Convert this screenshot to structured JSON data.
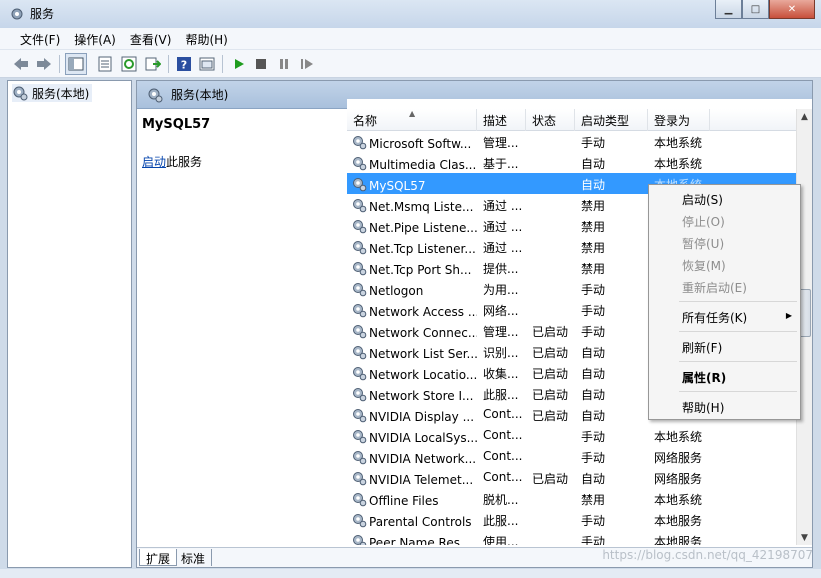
{
  "window": {
    "title": "服务"
  },
  "menubar": [
    "文件(F)",
    "操作(A)",
    "查看(V)",
    "帮助(H)"
  ],
  "tree": {
    "root": "服务(本地)"
  },
  "pane": {
    "header": "服务(本地)",
    "selected_service": "MySQL57",
    "start_link": "启动",
    "start_suffix": "此服务"
  },
  "columns": [
    "名称",
    "描述",
    "状态",
    "启动类型",
    "登录为"
  ],
  "rows": [
    {
      "name": "Microsoft Softw...",
      "desc": "管理...",
      "status": "",
      "startup": "手动",
      "logon": "本地系统"
    },
    {
      "name": "Multimedia Clas...",
      "desc": "基于...",
      "status": "",
      "startup": "自动",
      "logon": "本地系统"
    },
    {
      "name": "MySQL57",
      "desc": "",
      "status": "",
      "startup": "自动",
      "logon": "本地系统"
    },
    {
      "name": "Net.Msmq Liste...",
      "desc": "通过 ...",
      "status": "",
      "startup": "禁用",
      "logon": ""
    },
    {
      "name": "Net.Pipe Listene...",
      "desc": "通过 ...",
      "status": "",
      "startup": "禁用",
      "logon": ""
    },
    {
      "name": "Net.Tcp Listener...",
      "desc": "通过 ...",
      "status": "",
      "startup": "禁用",
      "logon": ""
    },
    {
      "name": "Net.Tcp Port Sh...",
      "desc": "提供...",
      "status": "",
      "startup": "禁用",
      "logon": ""
    },
    {
      "name": "Netlogon",
      "desc": "为用...",
      "status": "",
      "startup": "手动",
      "logon": ""
    },
    {
      "name": "Network Access ...",
      "desc": "网络...",
      "status": "",
      "startup": "手动",
      "logon": ""
    },
    {
      "name": "Network Connec...",
      "desc": "管理...",
      "status": "已启动",
      "startup": "手动",
      "logon": ""
    },
    {
      "name": "Network List Ser...",
      "desc": "识别...",
      "status": "已启动",
      "startup": "自动",
      "logon": ""
    },
    {
      "name": "Network Locatio...",
      "desc": "收集...",
      "status": "已启动",
      "startup": "自动",
      "logon": ""
    },
    {
      "name": "Network Store I...",
      "desc": "此服...",
      "status": "已启动",
      "startup": "自动",
      "logon": ""
    },
    {
      "name": "NVIDIA Display ...",
      "desc": "Cont...",
      "status": "已启动",
      "startup": "自动",
      "logon": ""
    },
    {
      "name": "NVIDIA LocalSys...",
      "desc": "Cont...",
      "status": "",
      "startup": "手动",
      "logon": "本地系统"
    },
    {
      "name": "NVIDIA Network...",
      "desc": "Cont...",
      "status": "",
      "startup": "手动",
      "logon": "网络服务"
    },
    {
      "name": "NVIDIA Telemet...",
      "desc": "Cont...",
      "status": "已启动",
      "startup": "自动",
      "logon": "网络服务"
    },
    {
      "name": "Offline Files",
      "desc": "脱机...",
      "status": "",
      "startup": "禁用",
      "logon": "本地系统"
    },
    {
      "name": "Parental Controls",
      "desc": "此服...",
      "status": "",
      "startup": "手动",
      "logon": "本地服务"
    },
    {
      "name": "Peer Name Res...",
      "desc": "使用...",
      "status": "",
      "startup": "手动",
      "logon": "本地服务"
    }
  ],
  "context_menu": {
    "start": "启动(S)",
    "stop": "停止(O)",
    "pause": "暂停(U)",
    "resume": "恢复(M)",
    "restart": "重新启动(E)",
    "all_tasks": "所有任务(K)",
    "refresh": "刷新(F)",
    "properties": "属性(R)",
    "help": "帮助(H)"
  },
  "tabs": [
    "扩展",
    "标准"
  ],
  "watermark": "https://blog.csdn.net/qq_42198707",
  "colors": {
    "selection": "#3399ff",
    "header": "#b5c9e2",
    "link": "#0645ad"
  },
  "icons": [
    "gear-icon",
    "back-arrow-icon",
    "forward-arrow-icon",
    "play-icon",
    "stop-icon",
    "pause-icon",
    "restart-icon",
    "help-icon"
  ]
}
